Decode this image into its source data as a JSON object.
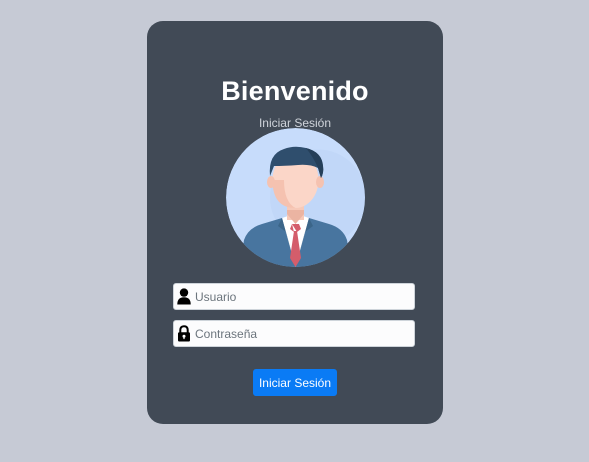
{
  "login": {
    "title": "Bienvenido",
    "subtitle": "Iniciar Sesión",
    "avatar_icon": "businessman-avatar-icon",
    "username": {
      "icon": "user-icon",
      "placeholder": "Usuario",
      "value": ""
    },
    "password": {
      "icon": "lock-icon",
      "placeholder": "Contraseña",
      "value": ""
    },
    "submit_label": "Iniciar Sesión"
  },
  "colors": {
    "background": "#c6cad5",
    "card": "#414a56",
    "button": "#0a7bf5",
    "input": "#fcfcfd"
  }
}
